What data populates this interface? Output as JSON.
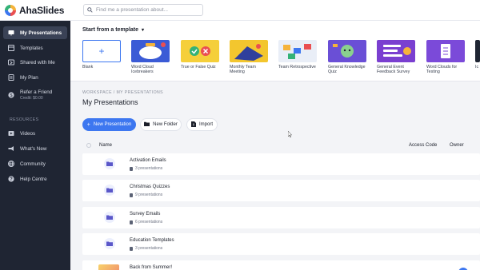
{
  "app": {
    "name": "AhaSlides"
  },
  "search": {
    "placeholder": "Find me a presentation about..."
  },
  "sidebar": {
    "items": [
      {
        "label": "My Presentations",
        "icon": "presentations-icon",
        "active": true
      },
      {
        "label": "Templates",
        "icon": "templates-icon"
      },
      {
        "label": "Shared with Me",
        "icon": "shared-icon"
      },
      {
        "label": "My Plan",
        "icon": "plan-icon"
      },
      {
        "label": "Refer a Friend",
        "sub": "Credit: $0.00",
        "icon": "dollar-icon"
      }
    ],
    "section_label": "RESOURCES",
    "resources": [
      {
        "label": "Videos",
        "icon": "video-icon"
      },
      {
        "label": "What's New",
        "icon": "megaphone-icon"
      },
      {
        "label": "Community",
        "icon": "globe-icon"
      },
      {
        "label": "Help Centre",
        "icon": "help-icon"
      }
    ]
  },
  "templates": {
    "heading": "Start from a template",
    "items": [
      {
        "label": "Blank"
      },
      {
        "label": "Word Cloud Icebreakers"
      },
      {
        "label": "True or False Quiz"
      },
      {
        "label": "Monthly Team Meeting"
      },
      {
        "label": "Team Retrospective"
      },
      {
        "label": "General Knowledge Quiz"
      },
      {
        "label": "General Event Feedback Survey"
      },
      {
        "label": "Word Clouds for Testing"
      },
      {
        "label": "Ic"
      }
    ]
  },
  "breadcrumb": "WORKSPACE  /  MY PRESENTATIONS",
  "page_title": "My Presentations",
  "actions": {
    "new_presentation": "New Presentation",
    "new_folder": "New Folder",
    "import": "Import"
  },
  "table": {
    "headers": {
      "name": "Name",
      "access_code": "Access Code",
      "owner": "Owner"
    },
    "rows": [
      {
        "name": "Activation Emails",
        "count": "3 presentations"
      },
      {
        "name": "Christmas Quizzes",
        "count": "9 presentations"
      },
      {
        "name": "Survey Emails",
        "count": "6 presentations"
      },
      {
        "name": "Education Templates",
        "count": "3 presentations"
      },
      {
        "name": "Back from Summer!",
        "count": ""
      }
    ]
  },
  "colors": {
    "accent": "#3d77f0",
    "sidebar_bg": "#1f2533"
  }
}
